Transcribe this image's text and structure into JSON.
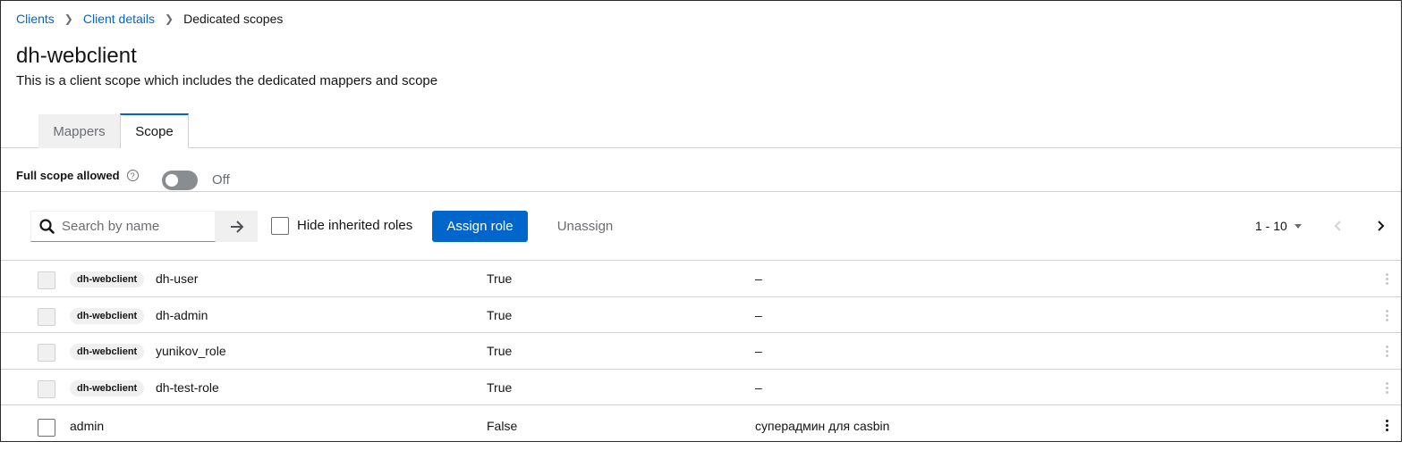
{
  "breadcrumb": {
    "items": [
      "Clients",
      "Client details"
    ],
    "current": "Dedicated scopes"
  },
  "header": {
    "title": "dh-webclient",
    "description": "This is a client scope which includes the dedicated mappers and scope"
  },
  "tabs": [
    {
      "label": "Mappers"
    },
    {
      "label": "Scope"
    }
  ],
  "full_scope": {
    "label": "Full scope allowed",
    "state": "Off"
  },
  "toolbar": {
    "search_placeholder": "Search by name",
    "hide_inherited_label": "Hide inherited roles",
    "assign_label": "Assign role",
    "unassign_label": "Unassign",
    "pagination": "1 - 10"
  },
  "rows": [
    {
      "badge": "dh-webclient",
      "name": "dh-user",
      "inherited": "True",
      "description": "–"
    },
    {
      "badge": "dh-webclient",
      "name": "dh-admin",
      "inherited": "True",
      "description": "–"
    },
    {
      "badge": "dh-webclient",
      "name": "yunikov_role",
      "inherited": "True",
      "description": "–"
    },
    {
      "badge": "dh-webclient",
      "name": "dh-test-role",
      "inherited": "True",
      "description": "–"
    },
    {
      "badge": "",
      "name": "admin",
      "inherited": "False",
      "description": "суперадмин для casbin"
    }
  ],
  "colors": {
    "accent": "#0066cc",
    "border": "#d2d2d2",
    "muted": "#6a6e73"
  }
}
